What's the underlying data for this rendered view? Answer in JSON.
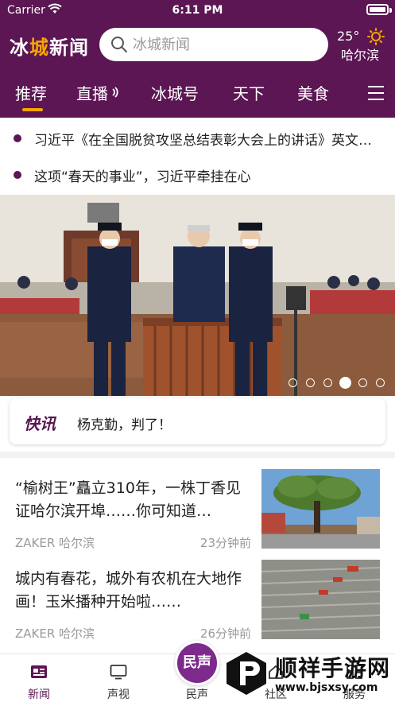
{
  "status_bar": {
    "carrier": "Carrier",
    "time": "6:11 PM"
  },
  "header": {
    "logo_part1": "冰",
    "logo_part2": "城",
    "logo_part3": "新闻",
    "search_placeholder": "冰城新闻",
    "weather": {
      "temp": "25°",
      "city": "哈尔滨",
      "icon": "sun-icon"
    }
  },
  "tabs": [
    {
      "label": "推荐",
      "active": true
    },
    {
      "label": "直播"
    },
    {
      "label": "冰城号"
    },
    {
      "label": "天下"
    },
    {
      "label": "美食"
    }
  ],
  "headlines": [
    "习近平《在全国脱贫攻坚总结表彰大会上的讲话》英文单行本出版发行",
    "这项“春天的事业”，习近平牵挂在心"
  ],
  "banner": {
    "slide_count": 6,
    "active_slide": 4
  },
  "flash": {
    "label": "快讯",
    "text": "杨克勤，判了！"
  },
  "news": [
    {
      "title": "“榆树王”矗立310年，一株丁香见证哈尔滨开埠……你可知道…",
      "source": "ZAKER 哈尔滨",
      "time": "23分钟前"
    },
    {
      "title": "城内有春花，城外有农机在大地作画！玉米播种开始啦……",
      "source": "ZAKER 哈尔滨",
      "time": "26分钟前"
    }
  ],
  "tabbar": {
    "items": [
      {
        "label": "新闻",
        "icon": "news-icon",
        "active": true
      },
      {
        "label": "声视",
        "icon": "tv-icon"
      },
      {
        "label": "民声",
        "icon": "minsheng-icon"
      },
      {
        "label": "社区",
        "icon": "community-icon"
      },
      {
        "label": "服务",
        "icon": "service-icon"
      }
    ],
    "center_button": "民声"
  },
  "watermark": {
    "name": "顺祥手游网",
    "url": "www.bjsxsy.com"
  },
  "colors": {
    "brand": "#5b1653",
    "accent": "#f7a600"
  }
}
